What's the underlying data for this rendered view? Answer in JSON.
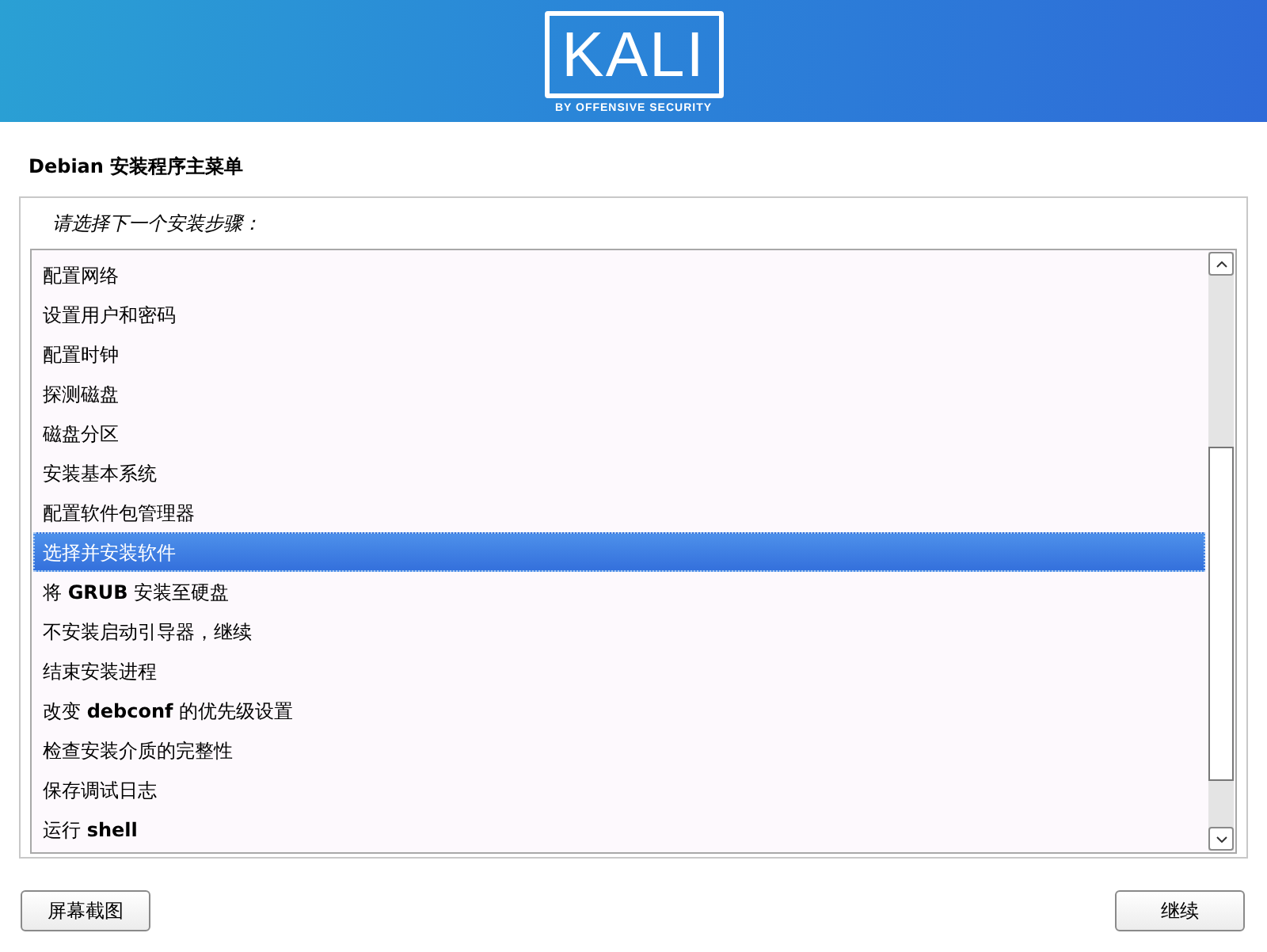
{
  "header": {
    "logo_text": "KALI",
    "logo_subtitle": "BY OFFENSIVE SECURITY"
  },
  "title": "Debian 安装程序主菜单",
  "prompt": "请选择下一个安装步骤：",
  "menu_items": [
    {
      "label": "配置网络",
      "selected": false
    },
    {
      "label": "设置用户和密码",
      "selected": false
    },
    {
      "label": "配置时钟",
      "selected": false
    },
    {
      "label": "探测磁盘",
      "selected": false
    },
    {
      "label": "磁盘分区",
      "selected": false
    },
    {
      "label": "安装基本系统",
      "selected": false
    },
    {
      "label": "配置软件包管理器",
      "selected": false
    },
    {
      "label": "选择并安装软件",
      "selected": true
    },
    {
      "label": "将 **GRUB** 安装至硬盘",
      "selected": false
    },
    {
      "label": "不安装启动引导器，继续",
      "selected": false
    },
    {
      "label": "结束安装进程",
      "selected": false
    },
    {
      "label": "改变 **debconf** 的优先级设置",
      "selected": false
    },
    {
      "label": "检查安装介质的完整性",
      "selected": false
    },
    {
      "label": "保存调试日志",
      "selected": false
    },
    {
      "label": "运行 **shell**",
      "selected": false
    }
  ],
  "buttons": [
    "屏幕截图",
    "继续"
  ]
}
